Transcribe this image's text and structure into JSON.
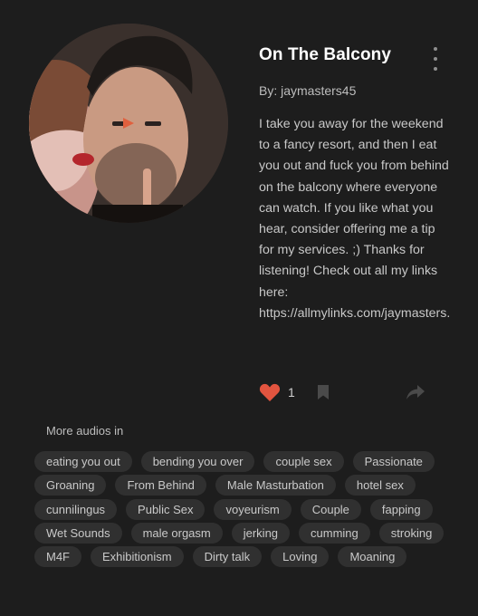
{
  "audio": {
    "title": "On The Balcony",
    "author": "By: jaymasters45",
    "description": "I take you away for the weekend to a fancy resort, and then I eat you out and fuck you from behind on the balcony where everyone can watch. If you like what you hear, consider offering me a tip for my services. ;) Thanks for listening! Check out all my links here: https://allmylinks.com/jaymasters.",
    "likes": "1"
  },
  "more_audios": {
    "heading": "More audios in",
    "tags": [
      "eating you out",
      "bending you over",
      "couple sex",
      "Passionate",
      "Groaning",
      "From Behind",
      "Male Masturbation",
      "hotel sex",
      "cunnilingus",
      "Public Sex",
      "voyeurism",
      "Couple",
      "fapping",
      "Wet Sounds",
      "male orgasm",
      "jerking",
      "cumming",
      "stroking",
      "M4F",
      "Exhibitionism",
      "Dirty talk",
      "Loving",
      "Moaning"
    ]
  },
  "icons": {
    "cover": "cover-art",
    "more": "kebab-menu-icon",
    "like": "heart-icon",
    "bookmark": "bookmark-icon",
    "share": "share-icon"
  },
  "colors": {
    "background": "#1d1d1d",
    "heart": "#e2543f",
    "tag_bg": "#303030"
  }
}
